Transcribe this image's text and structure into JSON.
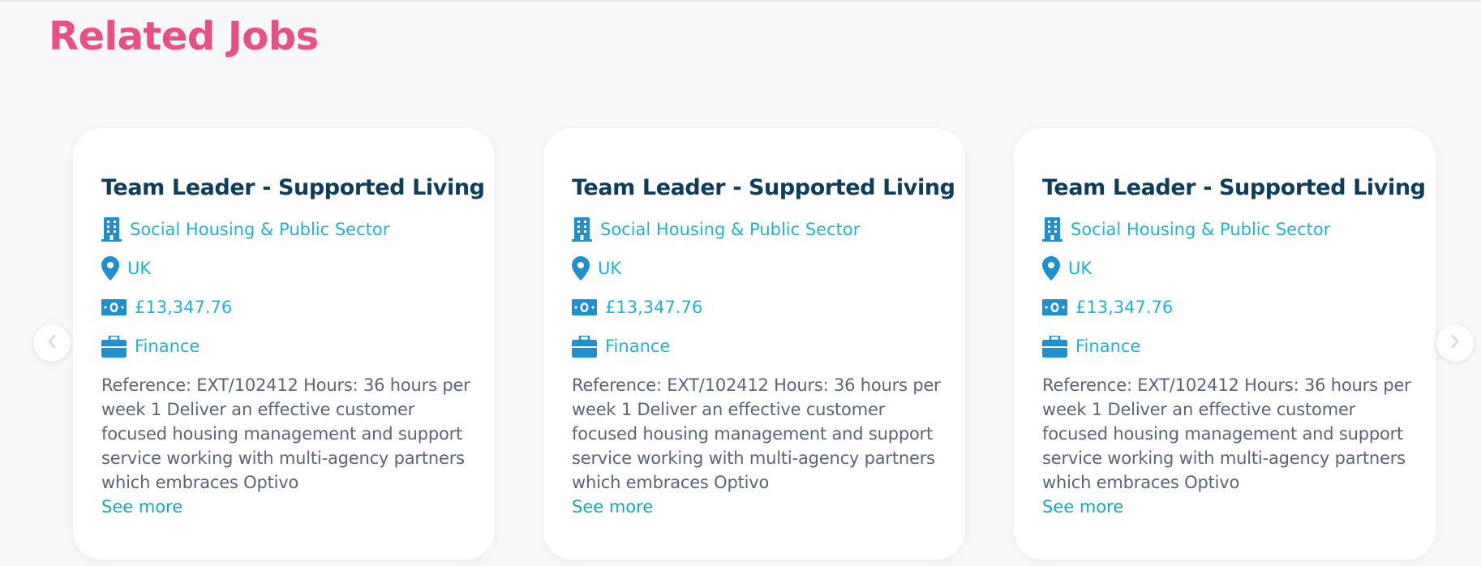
{
  "section": {
    "title": "Related Jobs"
  },
  "jobs": [
    {
      "title": "Team Leader - Supported Living",
      "sector": "Social Housing & Public Sector",
      "location": "UK",
      "salary": "£13,347.76",
      "category": "Finance",
      "description": "Reference: EXT/102412 Hours: 36 hours per week 1 Deliver an effective customer focused housing management and support service working with multi-agency partners which embraces Optivo",
      "see_more": "See more"
    },
    {
      "title": "Team Leader - Supported Living",
      "sector": "Social Housing & Public Sector",
      "location": "UK",
      "salary": "£13,347.76",
      "category": "Finance",
      "description": "Reference: EXT/102412 Hours: 36 hours per week 1 Deliver an effective customer focused housing management and support service working with multi-agency partners which embraces Optivo",
      "see_more": "See more"
    },
    {
      "title": "Team Leader - Supported Living",
      "sector": "Social Housing & Public Sector",
      "location": "UK",
      "salary": "£13,347.76",
      "category": "Finance",
      "description": "Reference: EXT/102412 Hours: 36 hours per week 1 Deliver an effective customer focused housing management and support service working with multi-agency partners which embraces Optivo",
      "see_more": "See more"
    }
  ],
  "icons": {
    "sector": "building-icon",
    "location": "map-pin-icon",
    "salary": "money-icon",
    "category": "briefcase-icon",
    "prev": "chevron-left-icon",
    "next": "chevron-right-icon"
  },
  "colors": {
    "title_pink": "#ea4f84",
    "card_title": "#0d3d5a",
    "meta_teal": "#21b3cc",
    "icon_blue": "#1e8fcf",
    "body_text": "#5a6478",
    "link": "#13a8b8"
  }
}
